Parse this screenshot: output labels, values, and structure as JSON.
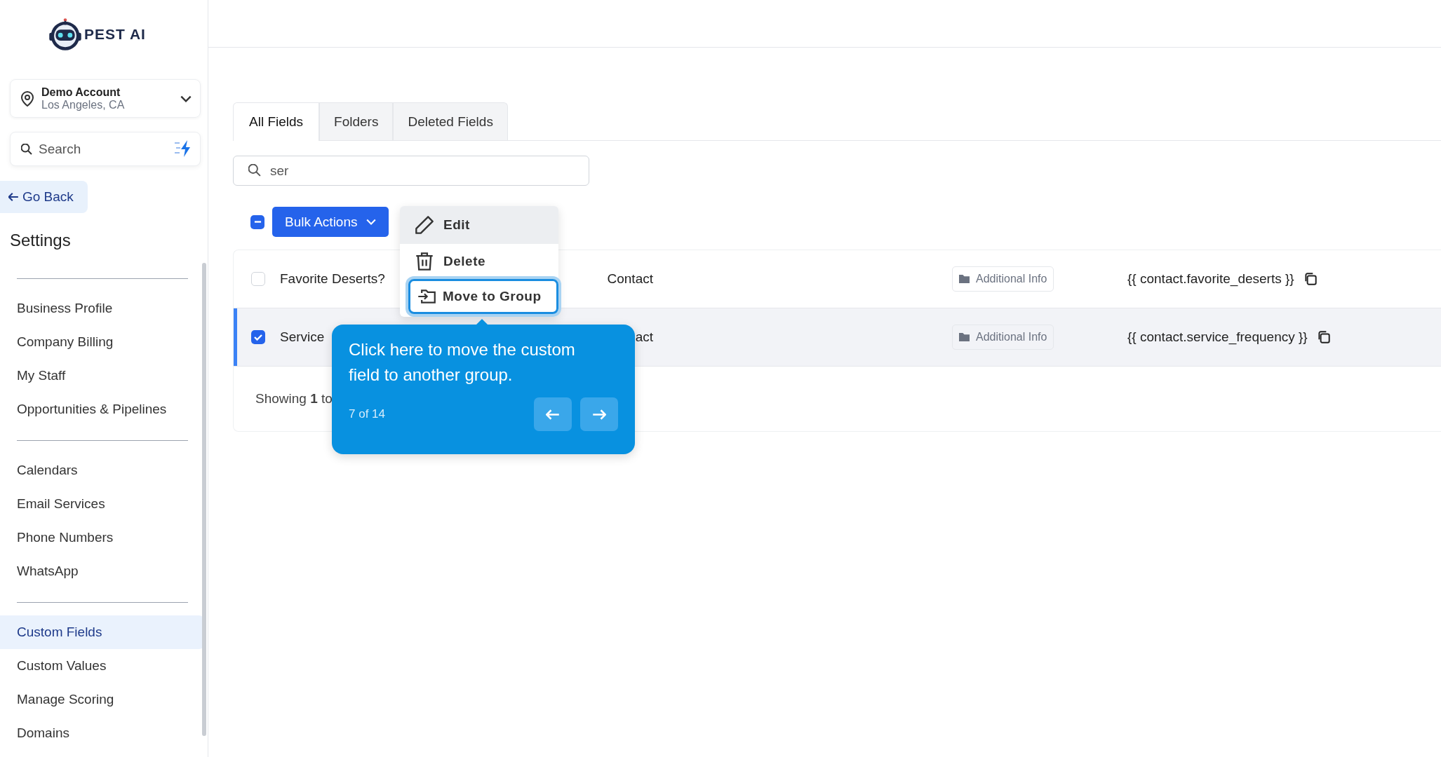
{
  "sidebar": {
    "logo_text": "PEST AI",
    "account": {
      "name": "Demo Account",
      "location": "Los Angeles, CA"
    },
    "search": {
      "placeholder": "Search"
    },
    "back": "Go Back",
    "heading": "Settings",
    "groups": [
      [
        {
          "label": "Business Profile",
          "selected": false
        },
        {
          "label": "Company Billing",
          "selected": false
        },
        {
          "label": "My Staff",
          "selected": false
        },
        {
          "label": "Opportunities & Pipelines",
          "selected": false
        }
      ],
      [
        {
          "label": "Calendars",
          "selected": false
        },
        {
          "label": "Email Services",
          "selected": false
        },
        {
          "label": "Phone Numbers",
          "selected": false
        },
        {
          "label": "WhatsApp",
          "selected": false
        }
      ],
      [
        {
          "label": "Custom Fields",
          "selected": true
        },
        {
          "label": "Custom Values",
          "selected": false
        },
        {
          "label": "Manage Scoring",
          "selected": false
        },
        {
          "label": "Domains",
          "selected": false
        }
      ]
    ]
  },
  "tabs": [
    {
      "label": "All Fields",
      "selected": true
    },
    {
      "label": "Folders",
      "selected": false
    },
    {
      "label": "Deleted Fields",
      "selected": false
    }
  ],
  "search": {
    "value": "ser"
  },
  "bulk": {
    "indeterminate": true,
    "label": "Bulk Actions"
  },
  "menu": [
    {
      "kind": "edit",
      "label": "Edit",
      "hovered": true,
      "focused": false
    },
    {
      "kind": "delete",
      "label": "Delete",
      "hovered": false,
      "focused": false
    },
    {
      "kind": "move",
      "label": "Move to Group",
      "hovered": false,
      "focused": true
    }
  ],
  "rows": [
    {
      "checked": false,
      "selected": false,
      "name": "Favorite Deserts?",
      "type": "Contact",
      "folder": "Additional Info",
      "key": "{{ contact.favorite_deserts }}"
    },
    {
      "checked": true,
      "selected": true,
      "name": "Service",
      "type": "act",
      "folder": "Additional Info",
      "key": "{{ contact.service_frequency }}"
    }
  ],
  "footer": "Showing **1** to",
  "tour": {
    "text": "Click here to move the custom field to another group.",
    "step": "7 of 14"
  }
}
